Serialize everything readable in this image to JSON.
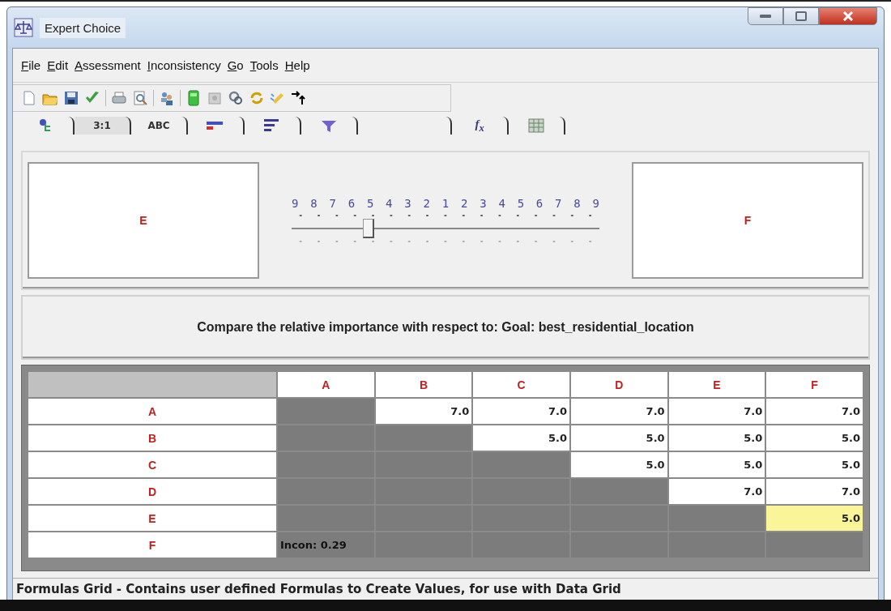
{
  "window": {
    "title": "Expert Choice"
  },
  "menu": [
    "File",
    "Edit",
    "Assessment",
    "Inconsistency",
    "Go",
    "Tools",
    "Help"
  ],
  "toolbar": [
    {
      "kind": "new"
    },
    {
      "kind": "open"
    },
    {
      "kind": "save"
    },
    {
      "kind": "check"
    },
    {
      "kind": "sep"
    },
    {
      "kind": "print"
    },
    {
      "kind": "preview"
    },
    {
      "kind": "sep"
    },
    {
      "kind": "people"
    },
    {
      "kind": "sep"
    },
    {
      "kind": "calc"
    },
    {
      "kind": "disk"
    },
    {
      "kind": "gears"
    },
    {
      "kind": "cycle"
    },
    {
      "kind": "pen"
    },
    {
      "kind": "arrows"
    }
  ],
  "tabs": [
    {
      "kind": "tree",
      "selected": false
    },
    {
      "kind": "text",
      "label": "3:1",
      "selected": true
    },
    {
      "kind": "text",
      "label": "ABC",
      "selected": false
    },
    {
      "kind": "bars",
      "selected": false
    },
    {
      "kind": "lines",
      "selected": false
    },
    {
      "kind": "funnel",
      "selected": false
    },
    {
      "kind": "blank",
      "selected": false
    },
    {
      "kind": "formula",
      "label": "f$_{x}$",
      "selected": false
    },
    {
      "kind": "grid",
      "selected": false
    }
  ],
  "comparison": {
    "left": "E",
    "right": "F",
    "scale": [
      "9",
      "8",
      "7",
      "6",
      "5",
      "4",
      "3",
      "2",
      "1",
      "2",
      "3",
      "4",
      "5",
      "6",
      "7",
      "8",
      "9"
    ],
    "level": 0.25
  },
  "prompt": "Compare the relative importance with respect to: Goal: best_residential_location",
  "grid": {
    "columns": [
      "A",
      "B",
      "C",
      "D",
      "E",
      "F"
    ],
    "rows": [
      {
        "label": "A",
        "cells": [
          {
            "kind": "shaded"
          },
          {
            "kind": "value",
            "text": "7.0",
            "selected": false
          },
          {
            "kind": "value",
            "text": "7.0",
            "selected": false
          },
          {
            "kind": "value",
            "text": "7.0",
            "selected": false
          },
          {
            "kind": "value",
            "text": "7.0",
            "selected": false
          },
          {
            "kind": "value",
            "text": "7.0",
            "selected": false
          }
        ]
      },
      {
        "label": "B",
        "cells": [
          {
            "kind": "shaded"
          },
          {
            "kind": "shaded"
          },
          {
            "kind": "value",
            "text": "5.0",
            "selected": false
          },
          {
            "kind": "value",
            "text": "5.0",
            "selected": false
          },
          {
            "kind": "value",
            "text": "5.0",
            "selected": false
          },
          {
            "kind": "value",
            "text": "5.0",
            "selected": false
          }
        ]
      },
      {
        "label": "C",
        "cells": [
          {
            "kind": "shaded"
          },
          {
            "kind": "shaded"
          },
          {
            "kind": "shaded"
          },
          {
            "kind": "value",
            "text": "5.0",
            "selected": false
          },
          {
            "kind": "value",
            "text": "5.0",
            "selected": false
          },
          {
            "kind": "value",
            "text": "5.0",
            "selected": false
          }
        ]
      },
      {
        "label": "D",
        "cells": [
          {
            "kind": "shaded"
          },
          {
            "kind": "shaded"
          },
          {
            "kind": "shaded"
          },
          {
            "kind": "shaded"
          },
          {
            "kind": "value",
            "text": "7.0",
            "selected": false
          },
          {
            "kind": "value",
            "text": "7.0",
            "selected": false
          }
        ]
      },
      {
        "label": "E",
        "cells": [
          {
            "kind": "shaded"
          },
          {
            "kind": "shaded"
          },
          {
            "kind": "shaded"
          },
          {
            "kind": "shaded"
          },
          {
            "kind": "shaded"
          },
          {
            "kind": "value",
            "text": "5.0",
            "selected": true
          }
        ]
      },
      {
        "label": "F",
        "cells": [
          {
            "kind": "shaded",
            "text": "Incon: 0.29"
          },
          {
            "kind": "shaded"
          },
          {
            "kind": "shaded"
          },
          {
            "kind": "shaded"
          },
          {
            "kind": "shaded"
          },
          {
            "kind": "shaded"
          }
        ]
      }
    ]
  },
  "status_bar": "Formulas Grid - Contains user defined Formulas to Create Values, for use with Data Grid"
}
